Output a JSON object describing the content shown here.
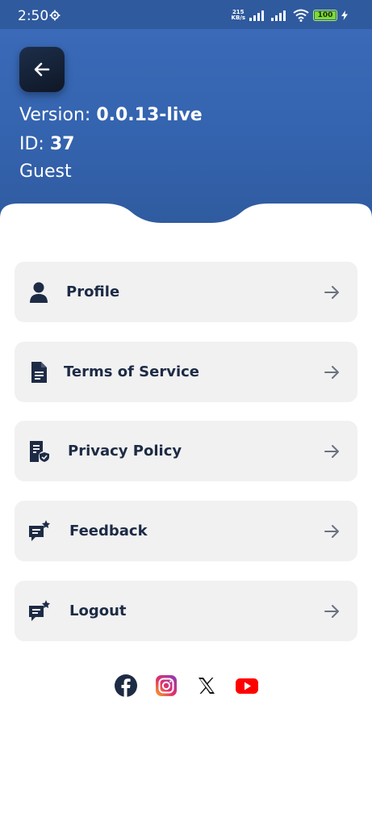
{
  "status_bar": {
    "time": "2:50",
    "net_speed_value": "215",
    "net_speed_unit": "KB/s",
    "battery": "100"
  },
  "header": {
    "version_label": "Version:",
    "version_value": "0.0.13-live",
    "id_label": "ID:",
    "id_value": "37",
    "user_role": "Guest"
  },
  "menu": [
    {
      "label": "Profile",
      "icon": "person-icon"
    },
    {
      "label": "Terms of Service",
      "icon": "document-icon"
    },
    {
      "label": "Privacy Policy",
      "icon": "shield-document-icon"
    },
    {
      "label": "Feedback",
      "icon": "chat-star-icon"
    },
    {
      "label": "Logout",
      "icon": "chat-star-icon"
    }
  ],
  "socials": [
    "facebook-icon",
    "instagram-icon",
    "x-icon",
    "youtube-icon"
  ],
  "colors": {
    "header": "#3463ae",
    "menu_bg": "#f1f1f1",
    "menu_text": "#1d2b45",
    "arrow": "#6b7280"
  }
}
